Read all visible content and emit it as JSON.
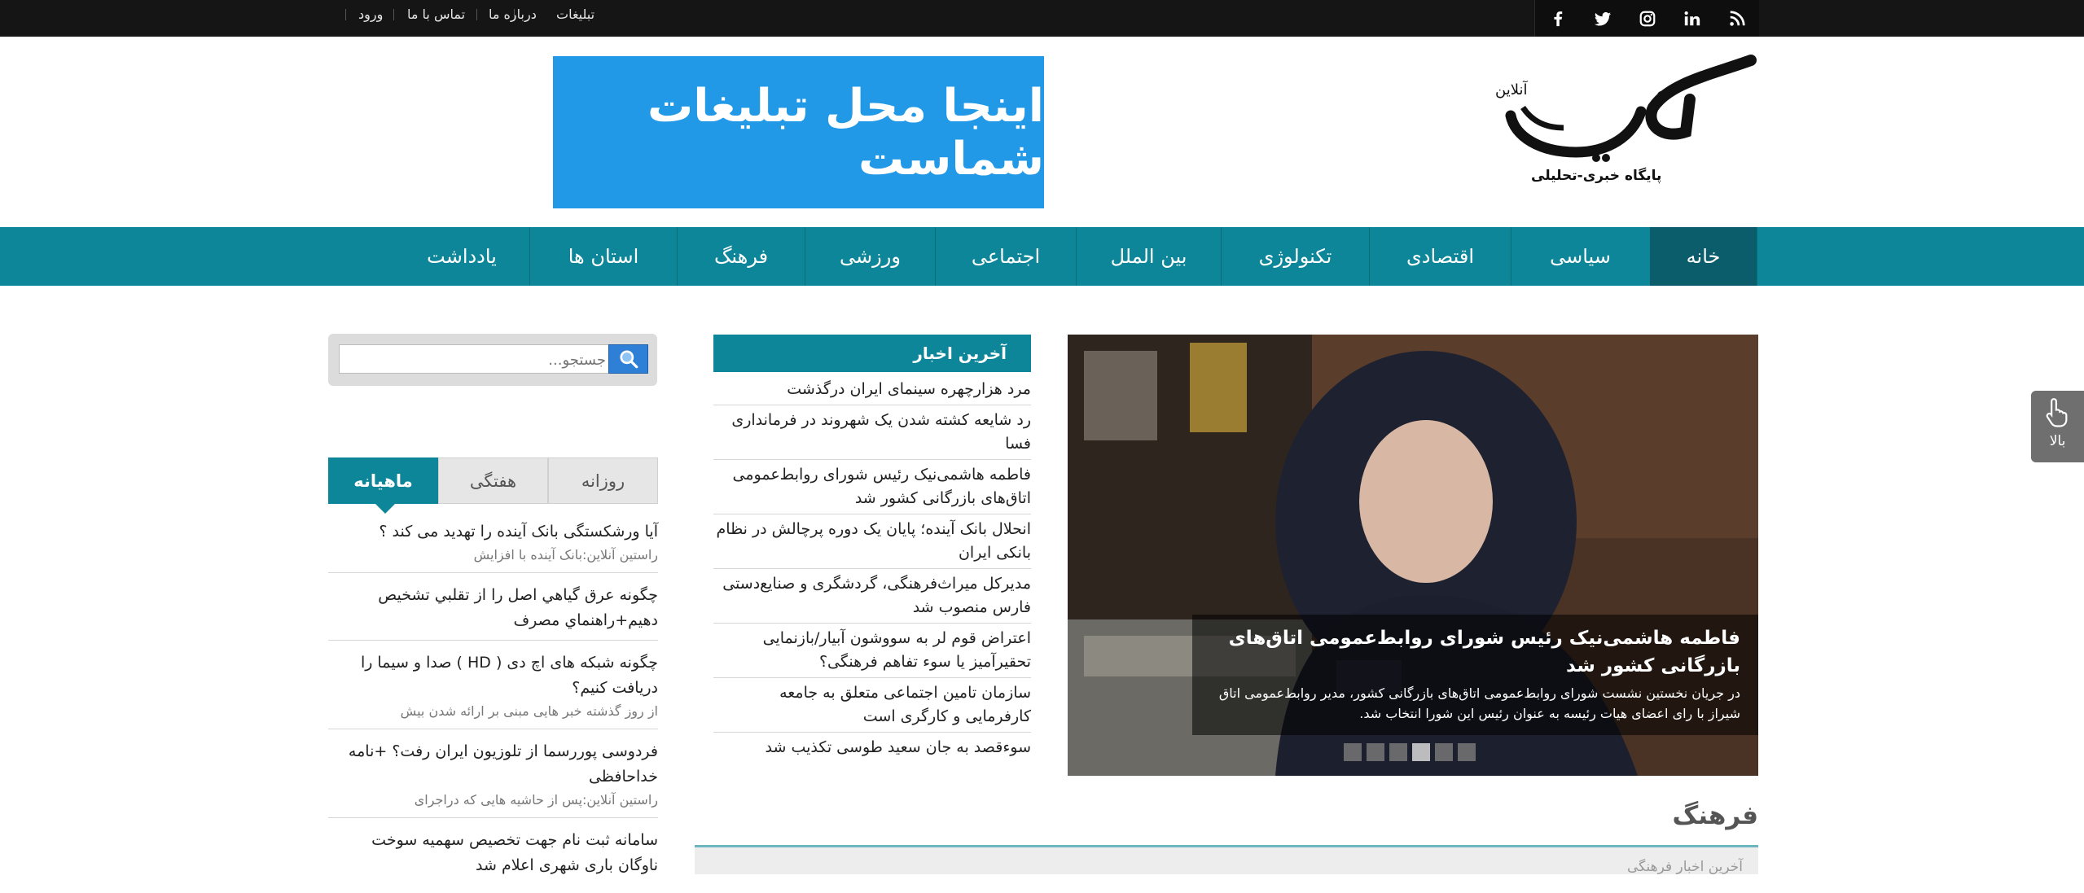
{
  "topbar": {
    "links": [
      "تبلیغات",
      "درباره ما",
      "تماس با ما",
      "ورود"
    ],
    "social_icons": [
      "rss-icon",
      "linkedin-icon",
      "instagram-icon",
      "twitter-icon",
      "facebook-icon"
    ]
  },
  "header": {
    "logo_name": "راستین",
    "logo_tag": "آنلاین",
    "logo_subtitle": "پایگاه خبری-تحلیلی",
    "banner_text": "اینجا محل تبلیغات شماست"
  },
  "nav": {
    "items": [
      "خانه",
      "سیاسی",
      "اقتصادی",
      "تکنولوژی",
      "بین الملل",
      "اجتماعی",
      "ورزشی",
      "فرهنگ",
      "استان ها",
      "یادداشت"
    ],
    "active": "خانه"
  },
  "slider": {
    "title": "فاطمه هاشمی‌نیک رئیس شورای روابط‌عمومی اتاق‌های بازرگانی کشور شد",
    "description": "در جریان نخستین نشست شورای روابط‌عمومی اتاق‌های بازرگانی کشور، مدیر روابط‌عمومی اتاق شیراز با رای اعضای هیات رئیسه به عنوان رئیس این شورا انتخاب شد.",
    "slide_count": 6,
    "active_slide": 4
  },
  "latest": {
    "heading": "آخرین اخبار",
    "items": [
      "مرد هزارچهره سینمای ایران درگذشت",
      "رد شایعه کشته شدن یک شهروند در فرمانداری فسا",
      "فاطمه هاشمی‌نیک رئیس شورای روابط‌عمومی اتاق‌های بازرگانی کشور شد",
      "انحلال بانک آینده؛ پایان یک دوره پرچالش در نظام بانکی ایران",
      "مدیرکل میراث‌فرهنگی، گردشگری و صنایع‌دستی فارس منصوب شد",
      "اعتراض قوم لر به سووشون آبیار/بازنمایی تحقیرآمیز یا سوء تفاهم فرهنگی؟",
      "سازمان تامین اجتماعی متعلق به جامعه کارفرمایی و کارگری است",
      "سوءقصد به جان سعید طوسی تکذیب شد"
    ]
  },
  "search": {
    "placeholder": "جستجو..."
  },
  "tabs": {
    "items": [
      "روزانه",
      "هفتگی",
      "ماهیانه"
    ],
    "active": "ماهیانه"
  },
  "popular": [
    {
      "title": "آیا ورشکستگی بانک آینده را تهدید می کند ؟",
      "meta": "راستین آنلاین:بانک آینده   با افزایش"
    },
    {
      "title": "چگونه عرق گياهي اصل را از تقلبي تشخيص دهيم+راهنماي مصرف",
      "meta": ""
    },
    {
      "title": "چگونه شبکه های اچ دی ( HD ) صدا و سیما را دریافت کنیم؟",
      "meta": "از روز گذشته خبر هایی مبنی بر ارائه شدن بیش"
    },
    {
      "title": "فردوسی پوررسما از تلوزیون ایران رفت؟ +نامه خداحافظی",
      "meta": "راستین آنلاین:پس از حاشیه هایی که دراجرای"
    },
    {
      "title": "سامانه ثبت نام جهت تخصیص سهمیه سوخت ناوگان باری شهری اعلام شد",
      "meta": ""
    }
  ],
  "back_to_top": {
    "label": "بالا"
  },
  "culture": {
    "heading": "فرهنگ",
    "subheading": "آخرین اخبار فرهنگی"
  },
  "colors": {
    "accent": "#0c8698",
    "accent_dark": "#0b5d6b",
    "topbar": "#151515",
    "banner": "#2299e6"
  }
}
